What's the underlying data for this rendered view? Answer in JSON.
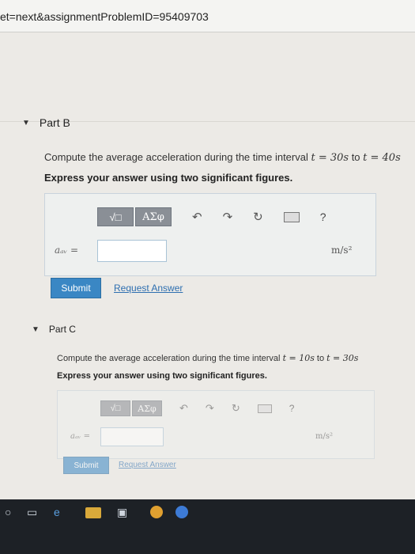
{
  "url": "et=next&assignmentProblemID=95409703",
  "partB": {
    "title": "Part B",
    "question_prefix": "Compute the average acceleration during the time interval ",
    "question_math1": "t = 30s",
    "question_mid": " to ",
    "question_math2": "t = 40s",
    "instruction": "Express your answer using two significant figures.",
    "toolbar": {
      "template_label": "√□",
      "symbols_label": "ΑΣφ",
      "help": "?"
    },
    "variable": "aₐᵥ =",
    "input_value": "",
    "unit": "m/s²",
    "submit_label": "Submit",
    "request_label": "Request Answer"
  },
  "partC": {
    "title": "Part C",
    "question_prefix": "Compute the average acceleration during the time interval ",
    "question_math1": "t = 10s",
    "question_mid": " to ",
    "question_math2": "t = 30s",
    "instruction": "Express your answer using two significant figures.",
    "toolbar": {
      "template_label": "√□",
      "symbols_label": "ΑΣφ",
      "help": "?"
    },
    "variable": "aₐᵥ =",
    "input_value": "",
    "unit": "m/s²",
    "submit_label": "Submit",
    "request_label": "Request Answer"
  }
}
